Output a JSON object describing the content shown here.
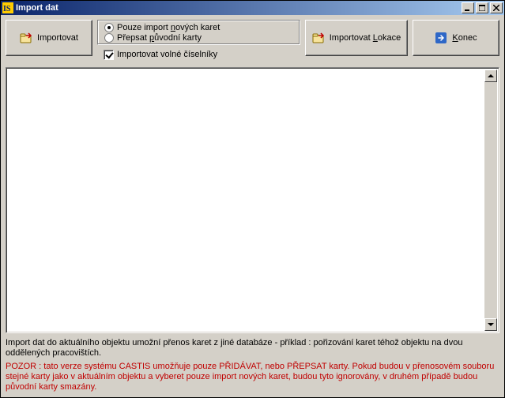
{
  "window": {
    "title": "Import dat"
  },
  "toolbar": {
    "import_label": "Importovat",
    "import_lokace_label_prefix": "Importovat ",
    "import_lokace_label_u": "L",
    "import_lokace_label_suffix": "okace",
    "konec_label_u": "K",
    "konec_label_suffix": "onec"
  },
  "options": {
    "radio1_prefix": "Pouze import ",
    "radio1_u": "n",
    "radio1_suffix": "ových karet",
    "radio1_selected": true,
    "radio2_prefix": "Přepsat ",
    "radio2_u": "p",
    "radio2_suffix": "ůvodní karty",
    "radio2_selected": false,
    "checkbox_label": "Importovat volné číselníky",
    "checkbox_checked": true
  },
  "footer": {
    "info_text": "Import dat do aktuálního objektu umožní přenos karet z jiné databáze - příklad : pořizování karet téhož objektu na dvou oddělených pracovištích.",
    "warn_text": "POZOR : tato verze systému CASTIS umožňuje pouze PŘIDÁVAT, nebo PŘEPSAT karty. Pokud budou v přenosovém souboru stejné karty jako v aktuálním objektu a vyberet pouze import nových karet, budou tyto ignorovány, v druhém případě budou původní karty smazány."
  }
}
